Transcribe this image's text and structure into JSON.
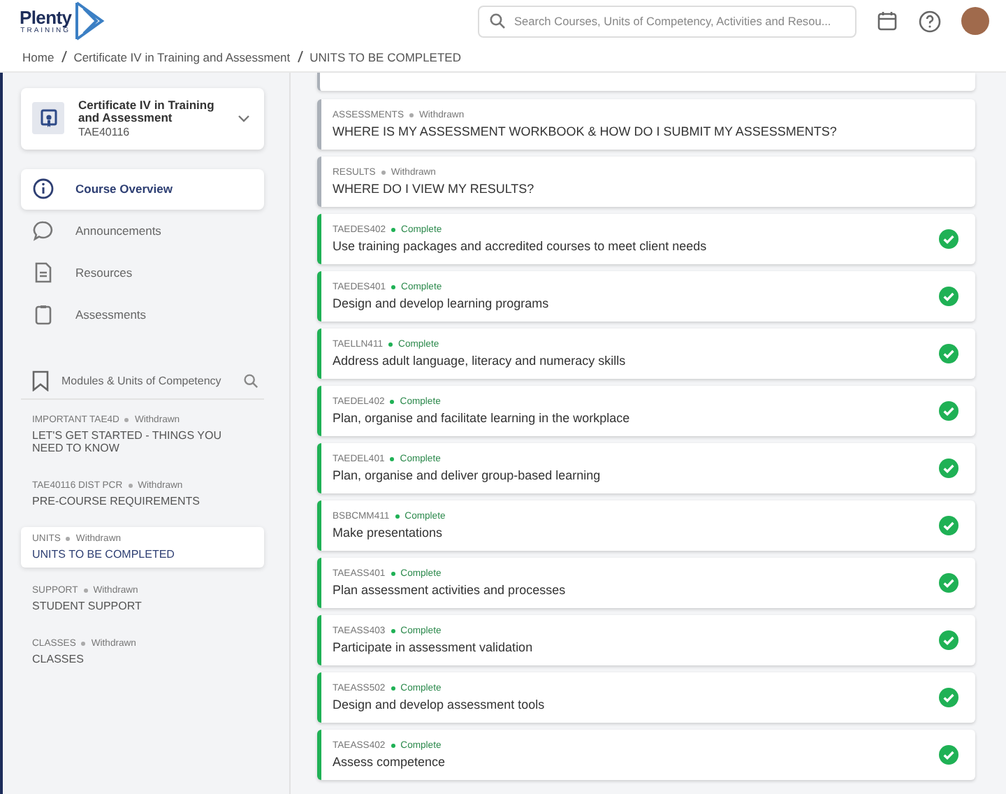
{
  "header": {
    "logo": {
      "name": "Plenty",
      "tagline": "TRAINING"
    },
    "search": {
      "placeholder": "Search Courses, Units of Competency, Activities and Resou..."
    }
  },
  "breadcrumb": [
    "Home",
    "Certificate IV in Training and Assessment",
    "UNITS TO BE COMPLETED"
  ],
  "sidebar": {
    "course": {
      "title": "Certificate IV in Training and Assessment",
      "code": "TAE40116"
    },
    "nav": [
      {
        "label": "Course Overview",
        "kind": "overview",
        "selected": true
      },
      {
        "label": "Announcements",
        "kind": "announcements",
        "selected": false
      },
      {
        "label": "Resources",
        "kind": "resources",
        "selected": false
      },
      {
        "label": "Assessments",
        "kind": "assessments",
        "selected": false
      }
    ],
    "modules_heading": "Modules & Units of Competency",
    "modules": [
      {
        "code": "IMPORTANT TAE4D",
        "status": "Withdrawn",
        "title": "LET'S GET STARTED - THINGS YOU NEED TO KNOW",
        "selected": false
      },
      {
        "code": "TAE40116 DIST PCR",
        "status": "Withdrawn",
        "title": "PRE-COURSE REQUIREMENTS",
        "selected": false
      },
      {
        "code": "UNITS",
        "status": "Withdrawn",
        "title": "UNITS TO BE COMPLETED",
        "selected": true
      },
      {
        "code": "SUPPORT",
        "status": "Withdrawn",
        "title": "STUDENT SUPPORT",
        "selected": false
      },
      {
        "code": "CLASSES",
        "status": "Withdrawn",
        "title": "CLASSES",
        "selected": false
      }
    ]
  },
  "units": [
    {
      "code": "ASSESSMENTS",
      "status": "Withdrawn",
      "kind": "withdrawn",
      "title": "WHERE IS MY ASSESSMENT WORKBOOK & HOW DO I SUBMIT MY ASSESSMENTS?"
    },
    {
      "code": "RESULTS",
      "status": "Withdrawn",
      "kind": "withdrawn",
      "title": "WHERE DO I VIEW MY RESULTS?"
    },
    {
      "code": "TAEDES402",
      "status": "Complete",
      "kind": "complete",
      "title": "Use training packages and accredited courses to meet client needs"
    },
    {
      "code": "TAEDES401",
      "status": "Complete",
      "kind": "complete",
      "title": "Design and develop learning programs"
    },
    {
      "code": "TAELLN411",
      "status": "Complete",
      "kind": "complete",
      "title": "Address adult language, literacy and numeracy skills"
    },
    {
      "code": "TAEDEL402",
      "status": "Complete",
      "kind": "complete",
      "title": "Plan, organise and facilitate learning in the workplace"
    },
    {
      "code": "TAEDEL401",
      "status": "Complete",
      "kind": "complete",
      "title": "Plan, organise and deliver group-based learning"
    },
    {
      "code": "BSBCMM411",
      "status": "Complete",
      "kind": "complete",
      "title": "Make presentations"
    },
    {
      "code": "TAEASS401",
      "status": "Complete",
      "kind": "complete",
      "title": "Plan assessment activities and processes"
    },
    {
      "code": "TAEASS403",
      "status": "Complete",
      "kind": "complete",
      "title": "Participate in assessment validation"
    },
    {
      "code": "TAEASS502",
      "status": "Complete",
      "kind": "complete",
      "title": "Design and develop assessment tools"
    },
    {
      "code": "TAEASS402",
      "status": "Complete",
      "kind": "complete",
      "title": "Assess competence"
    }
  ]
}
